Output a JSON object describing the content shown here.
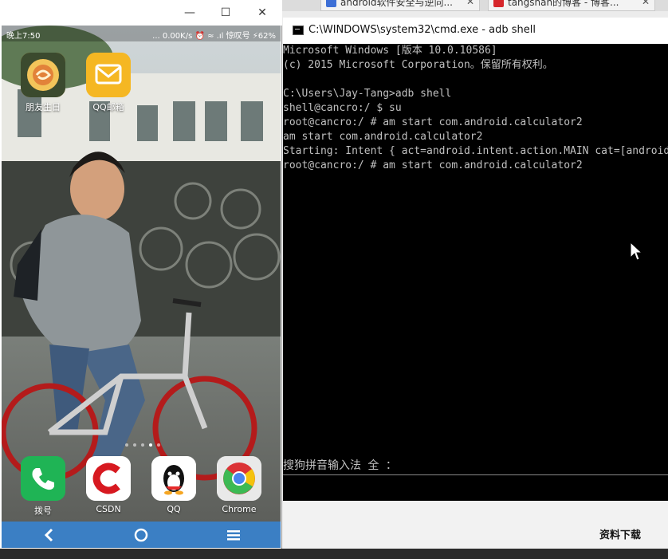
{
  "browser": {
    "tabs": [
      {
        "label": "android软件安全与逆向..."
      },
      {
        "label": "tangshan的博客 - 博客..."
      }
    ]
  },
  "phone_window": {
    "controls": {
      "minimize": "—",
      "maximize": "☐",
      "close": "✕"
    }
  },
  "phone": {
    "status": {
      "time": "晚上7:50",
      "right": "... 0.00K/s ⏰ ≈ .ıl 惊叹号 ⚡62%"
    },
    "apps_top": [
      {
        "label": "朋友生日"
      },
      {
        "label": "QQ邮箱"
      }
    ],
    "dock": [
      {
        "label": "拨号"
      },
      {
        "label": "CSDN"
      },
      {
        "label": "QQ"
      },
      {
        "label": "Chrome"
      }
    ]
  },
  "cmd": {
    "title": "C:\\WINDOWS\\system32\\cmd.exe - adb  shell",
    "lines": [
      "Microsoft Windows [版本 10.0.10586]",
      "(c) 2015 Microsoft Corporation。保留所有权利。",
      "",
      "C:\\Users\\Jay-Tang>adb shell",
      "shell@cancro:/ $ su",
      "root@cancro:/ # am start com.android.calculator2",
      "am start com.android.calculator2",
      "Starting: Intent { act=android.intent.action.MAIN cat=[android.intent.category.LAUNCHER] }",
      "root@cancro:/ # am start com.android.calculator2"
    ],
    "ime": "搜狗拼音输入法 全 ："
  },
  "footer": {
    "download_label": "资料下载"
  },
  "colors": {
    "navbar": "#3b7fc4",
    "cmd_bg": "#000000",
    "cmd_text": "#c0c0c0"
  }
}
